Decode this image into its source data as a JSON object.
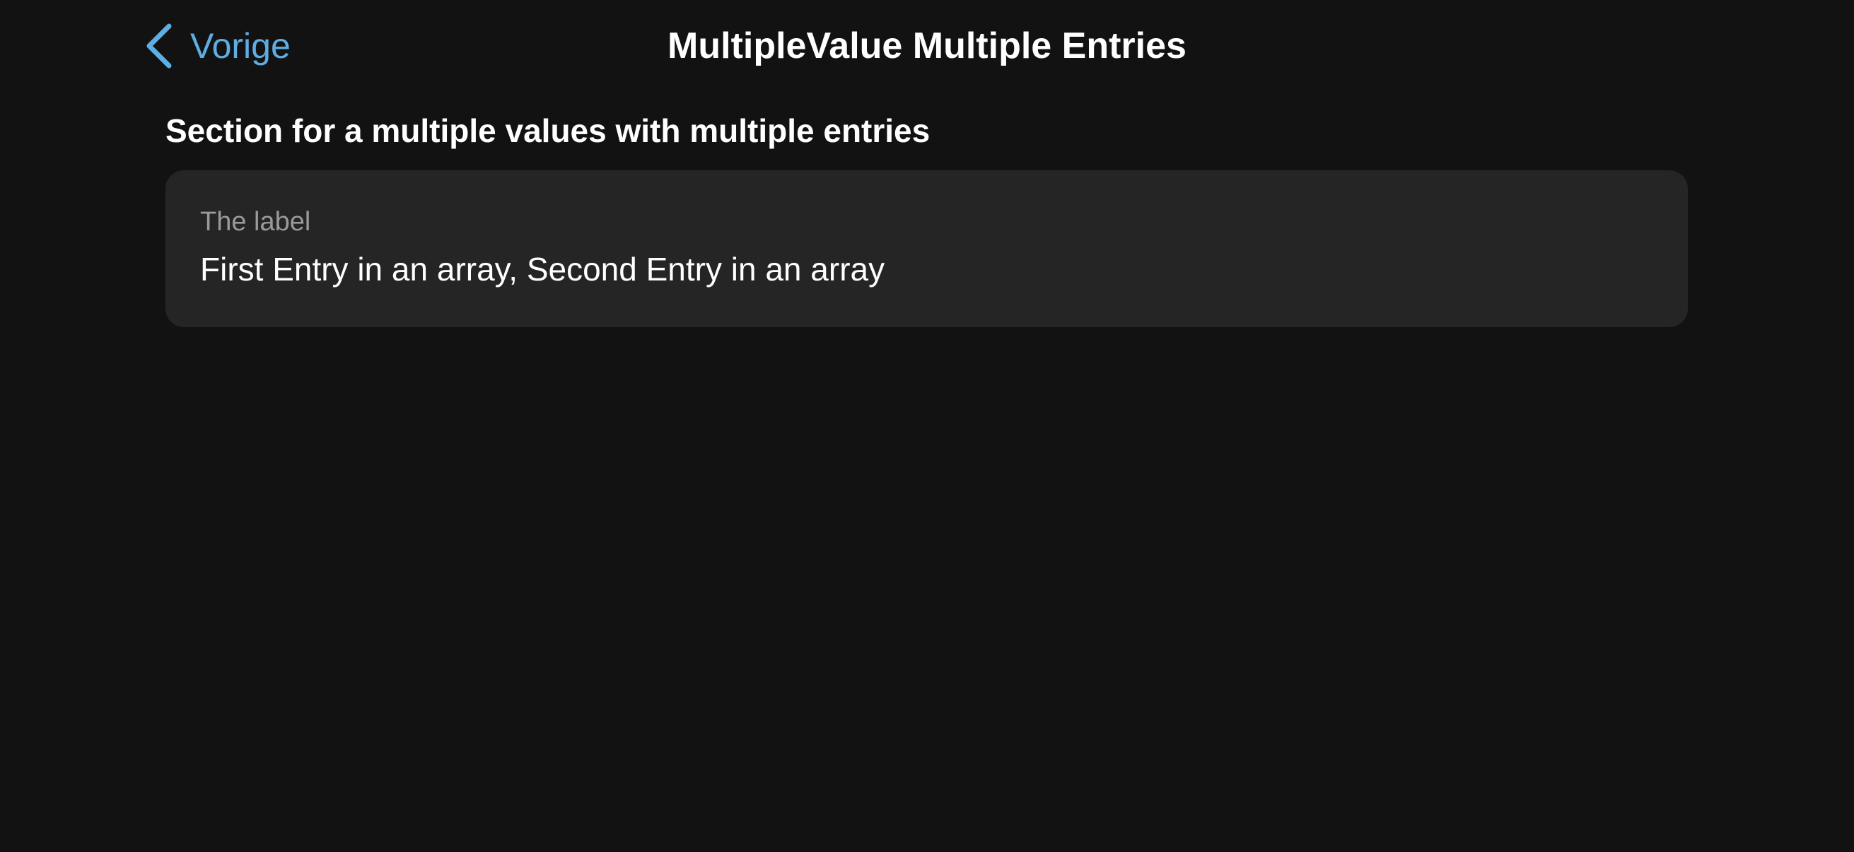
{
  "nav": {
    "back_label": "Vorige",
    "title": "MultipleValue Multiple Entries",
    "back_icon": "chevron-left-icon",
    "accent_color": "#5eaee3"
  },
  "section": {
    "header": "Section for a multiple values with multiple entries",
    "row": {
      "label": "The label",
      "value": "First Entry in an array, Second Entry in an array"
    }
  },
  "colors": {
    "background": "#121212",
    "card": "#252525",
    "label": "#9a9a9a",
    "text": "#ffffff"
  }
}
